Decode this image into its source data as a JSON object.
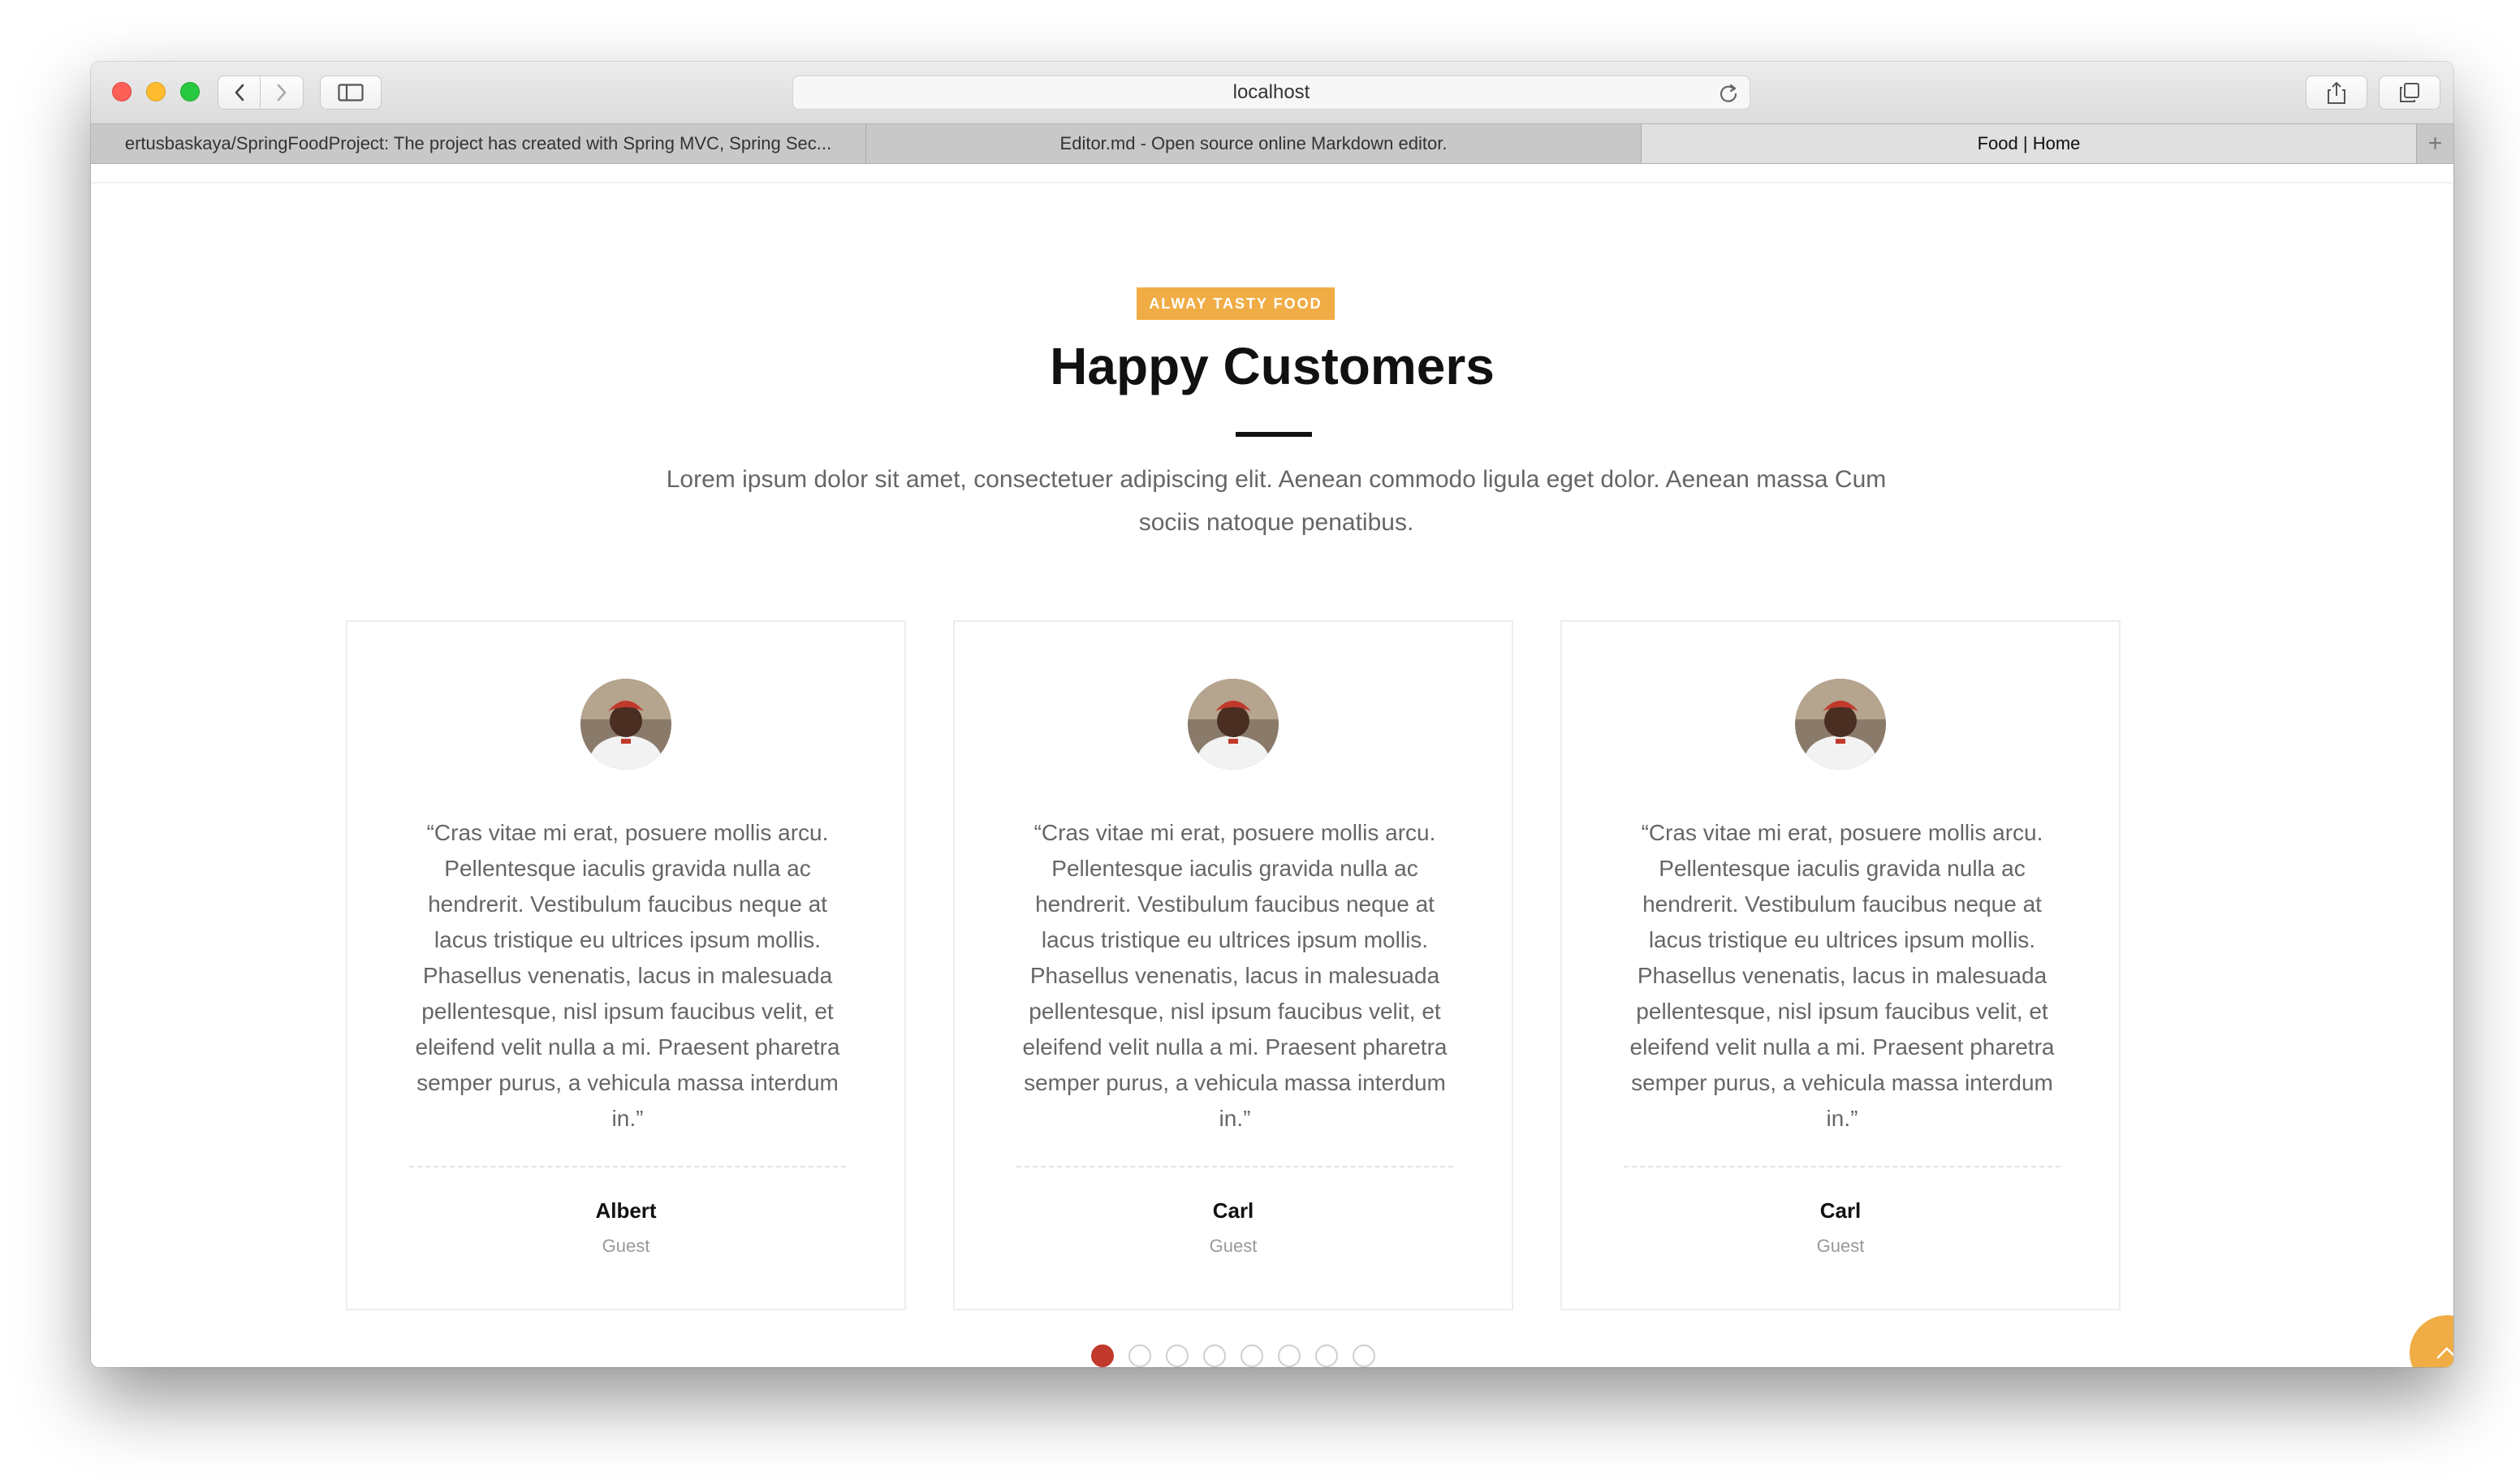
{
  "browser": {
    "address": "localhost",
    "tabs": [
      {
        "label": "ertusbaskaya/SpringFoodProject: The project has created with Spring MVC, Spring Sec...",
        "active": false
      },
      {
        "label": "Editor.md - Open source online Markdown editor.",
        "active": false
      },
      {
        "label": "Food | Home",
        "active": true
      }
    ],
    "icons": [
      "back-icon",
      "forward-icon",
      "sidebar-icon",
      "reload-icon",
      "share-icon",
      "tabs-overview-icon",
      "new-tab-icon"
    ]
  },
  "section": {
    "badge": "ALWAY TASTY FOOD",
    "title": "Happy Customers",
    "lead": "Lorem ipsum dolor sit amet, consectetuer adipiscing elit. Aenean commodo ligula eget dolor. Aenean massa Cum sociis natoque penatibus."
  },
  "testimonials": [
    {
      "quote": "“Cras vitae mi erat, posuere mollis arcu. Pellentesque iaculis gravida nulla ac hendrerit. Vestibulum faucibus neque at lacus tristique eu ultrices ipsum mollis. Phasellus venenatis, lacus in malesuada pellentesque, nisl ipsum faucibus velit, et eleifend velit nulla a mi. Praesent pharetra semper purus, a vehicula massa interdum in.”",
      "name": "Albert",
      "role": "Guest"
    },
    {
      "quote": "“Cras vitae mi erat, posuere mollis arcu. Pellentesque iaculis gravida nulla ac hendrerit. Vestibulum faucibus neque at lacus tristique eu ultrices ipsum mollis. Phasellus venenatis, lacus in malesuada pellentesque, nisl ipsum faucibus velit, et eleifend velit nulla a mi. Praesent pharetra semper purus, a vehicula massa interdum in.”",
      "name": "Carl",
      "role": "Guest"
    },
    {
      "quote": "“Cras vitae mi erat, posuere mollis arcu. Pellentesque iaculis gravida nulla ac hendrerit. Vestibulum faucibus neque at lacus tristique eu ultrices ipsum mollis. Phasellus venenatis, lacus in malesuada pellentesque, nisl ipsum faucibus velit, et eleifend velit nulla a mi. Praesent pharetra semper purus, a vehicula massa interdum in.”",
      "name": "Carl",
      "role": "Guest"
    }
  ],
  "carousel": {
    "dot_count": 8,
    "active_index": 0
  },
  "colors": {
    "accent": "#f0ad45",
    "active_dot": "#c0392b",
    "heading": "#111111",
    "body_text": "#666666"
  }
}
